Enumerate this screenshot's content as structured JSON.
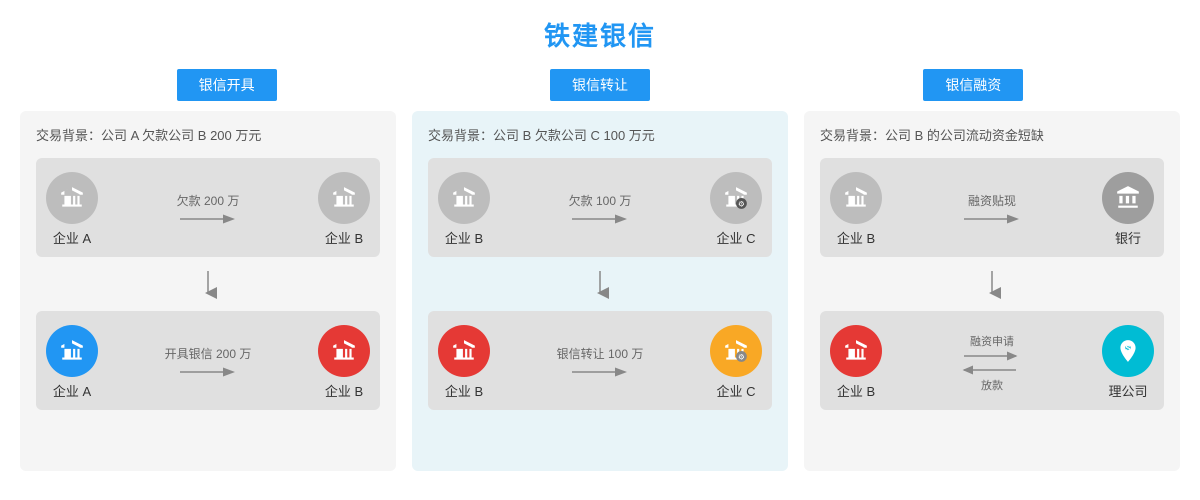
{
  "title": "铁建银信",
  "tabs": [
    {
      "label": "银信开具"
    },
    {
      "label": "银信转让"
    },
    {
      "label": "银信融资"
    }
  ],
  "columns": [
    {
      "id": "col1",
      "context": "交易背景：公司 A 欠款公司 B 200 万元",
      "top_flow": {
        "from_label": "企业 A",
        "from_icon": "gray",
        "arrow_text": "欠款 200 万",
        "to_label": "企业 B",
        "to_icon": "gray"
      },
      "bottom_flow": {
        "from_label": "企业 A",
        "from_icon": "blue",
        "arrow_text": "开具银信 200 万",
        "to_label": "企业 B",
        "to_icon": "red"
      }
    },
    {
      "id": "col2",
      "context": "交易背景：公司 B 欠款公司 C 100 万元",
      "top_flow": {
        "from_label": "企业 B",
        "from_icon": "gray",
        "arrow_text": "欠款 100 万",
        "to_label": "企业 C",
        "to_icon": "gray"
      },
      "bottom_flow": {
        "from_label": "企业 B",
        "from_icon": "red",
        "arrow_text": "银信转让 100 万",
        "to_label": "企业 C",
        "to_icon": "yellow"
      }
    },
    {
      "id": "col3",
      "context": "交易背景：公司 B 的公司流动资金短缺",
      "top_flow": {
        "from_label": "企业 B",
        "from_icon": "gray",
        "arrow_text": "融资贴现",
        "to_label": "银行",
        "to_icon": "gray_dollar"
      },
      "bottom_flow": {
        "from_label": "企业 B",
        "from_icon": "red",
        "arrow_text_up": "融资申请",
        "arrow_text_down": "放款",
        "to_label": "理公司",
        "to_icon": "cyan"
      }
    }
  ],
  "icons": {
    "building": "🏢",
    "building_gear": "🏭",
    "dollar": "💲",
    "bank": "🏦"
  }
}
